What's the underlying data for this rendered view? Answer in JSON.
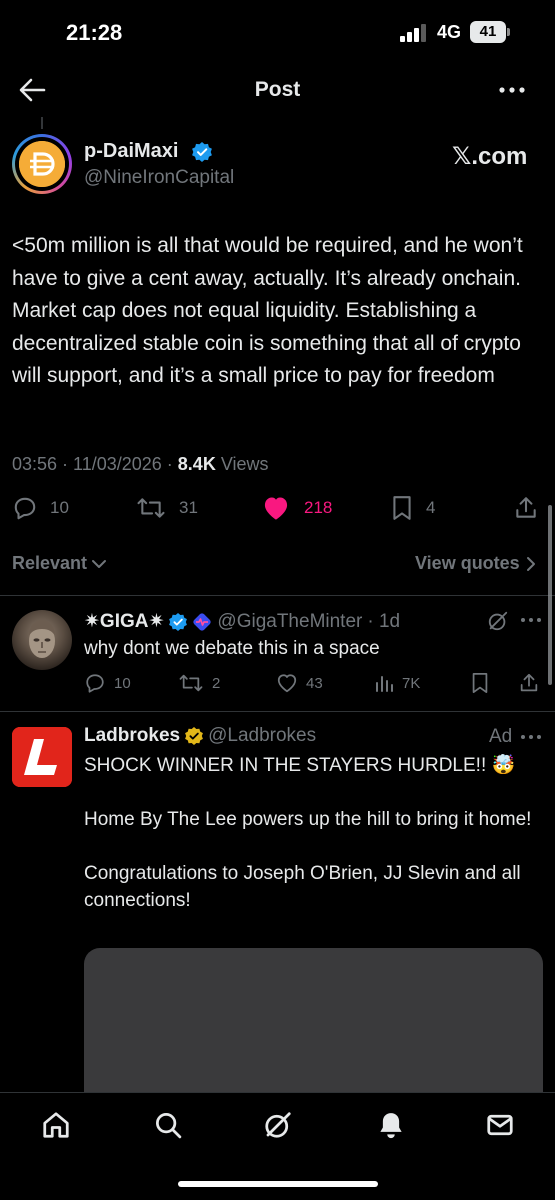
{
  "status": {
    "time": "21:28",
    "network": "4G",
    "battery": "41"
  },
  "header": {
    "title": "Post"
  },
  "post": {
    "author_name": "p-DaiMaxi",
    "author_handle": "@NineIronCapital",
    "source_label": "𝕏.com",
    "text": "<50m million is all that would be required, and he won’t have to give a cent away, actually. It’s already onchain. Market cap does not equal liquidity. Establishing a decentralized stable coin is something that all of crypto will support, and it’s a small price to pay for freedom",
    "timestamp": "03:56 · 11/03/2026 · ",
    "views_count": "8.4K",
    "views_label": " Views",
    "replies": "10",
    "reposts": "31",
    "likes": "218",
    "bookmarks": "4",
    "like_color": "#f91880"
  },
  "filters": {
    "sort_label": "Relevant",
    "quotes_label": "View quotes"
  },
  "reply": {
    "author_name": "✷GIGA✷",
    "author_handle": "@GigaTheMinter",
    "time": "· 1d",
    "text": "why dont we debate this in a space",
    "replies": "10",
    "reposts": "2",
    "likes": "43",
    "views": "7K"
  },
  "ad": {
    "author_name": "Ladbrokes",
    "author_handle": "@Ladbrokes",
    "ad_label": "Ad",
    "line1": "SHOCK WINNER IN THE STAYERS HURDLE!! 🤯",
    "line2": "Home By The Lee powers up the hill to bring it home!",
    "line3": "Congratulations to Joseph O'Brien, JJ Slevin and all connections!",
    "brand_color": "#e1251b"
  },
  "tabs": [
    "home-icon",
    "search-icon",
    "grok-icon",
    "notifications-icon",
    "messages-icon"
  ]
}
